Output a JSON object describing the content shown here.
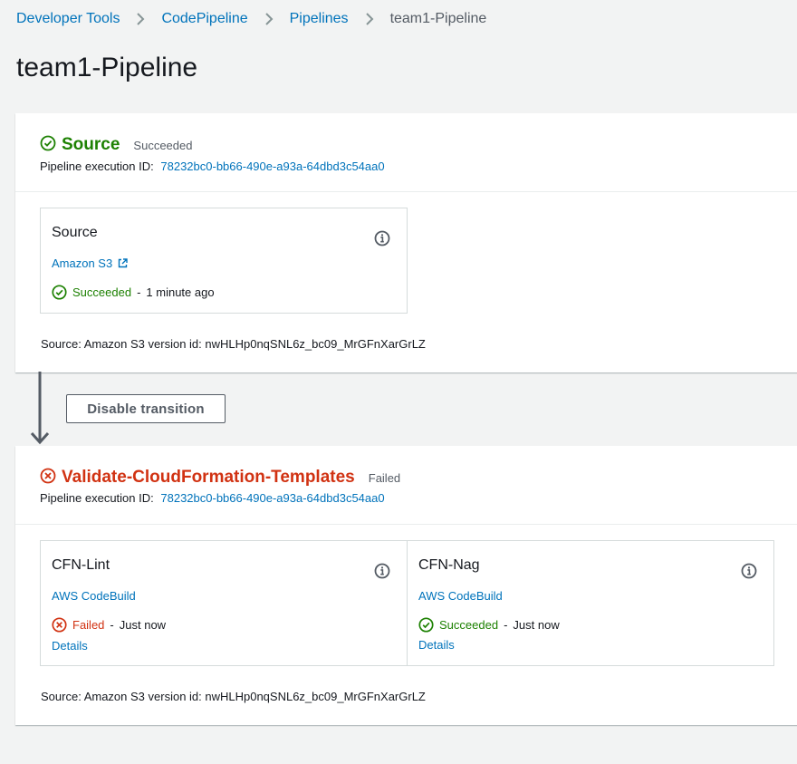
{
  "breadcrumb": {
    "items": [
      "Developer Tools",
      "CodePipeline",
      "Pipelines"
    ],
    "current": "team1-Pipeline"
  },
  "page_title": "team1-Pipeline",
  "colors": {
    "success": "#1d8102",
    "error": "#d13212",
    "link": "#0073bb"
  },
  "stages": [
    {
      "name": "Source",
      "status": "Succeeded",
      "exec_label": "Pipeline execution ID:",
      "exec_id": "78232bc0-bb66-490e-a93a-64dbd3c54aa0",
      "actions": [
        {
          "title": "Source",
          "provider": "Amazon S3",
          "provider_icon": "external-link-icon",
          "status": "Succeeded",
          "time": "1 minute ago"
        }
      ],
      "source_line": "Source: Amazon S3 version id: nwHLHp0nqSNL6z_bc09_MrGFnXarGrLZ"
    },
    {
      "name": "Validate-CloudFormation-Templates",
      "status": "Failed",
      "exec_label": "Pipeline execution ID:",
      "exec_id": "78232bc0-bb66-490e-a93a-64dbd3c54aa0",
      "actions": [
        {
          "title": "CFN-Lint",
          "provider": "AWS CodeBuild",
          "status": "Failed",
          "time": "Just now",
          "details": "Details"
        },
        {
          "title": "CFN-Nag",
          "provider": "AWS CodeBuild",
          "status": "Succeeded",
          "time": "Just now",
          "details": "Details"
        }
      ],
      "source_line": "Source: Amazon S3 version id: nwHLHp0nqSNL6z_bc09_MrGFnXarGrLZ"
    }
  ],
  "transition": {
    "button_label": "Disable transition"
  }
}
